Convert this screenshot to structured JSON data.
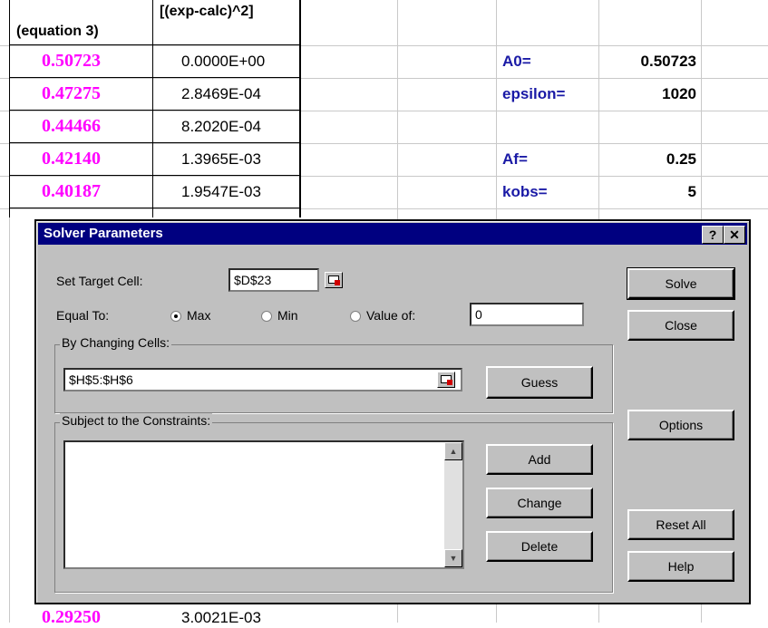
{
  "sheet": {
    "col_headers": [
      "(equation 3)",
      "[(exp-calc)^2]"
    ],
    "rows": [
      {
        "calc": "0.50723",
        "sq": "0.0000E+00"
      },
      {
        "calc": "0.47275",
        "sq": "2.8469E-04"
      },
      {
        "calc": "0.44466",
        "sq": "8.2020E-04"
      },
      {
        "calc": "0.42140",
        "sq": "1.3965E-03"
      },
      {
        "calc": "0.40187",
        "sq": "1.9547E-03"
      }
    ],
    "bottom_row": {
      "calc": "0.29250",
      "sq": "3.0021E-03"
    },
    "params": [
      {
        "label": "A0=",
        "value": "0.50723"
      },
      {
        "label": "epsilon=",
        "value": "1020"
      },
      {
        "label": "Af=",
        "value": "0.25"
      },
      {
        "label": "kobs=",
        "value": "5"
      }
    ]
  },
  "dialog": {
    "title": "Solver Parameters",
    "help_glyph": "?",
    "close_glyph": "✕",
    "target_label": "Set Target Cell:",
    "target_value": "$D$23",
    "equal_to_label": "Equal To:",
    "radio_max": "Max",
    "radio_min": "Min",
    "radio_value_of": "Value of:",
    "value_of_value": "0",
    "changing_label": "By Changing Cells:",
    "changing_value": "$H$5:$H$6",
    "constraints_label": "Subject to the Constraints:",
    "buttons": {
      "solve": "Solve",
      "close": "Close",
      "guess": "Guess",
      "options": "Options",
      "add": "Add",
      "change": "Change",
      "delete": "Delete",
      "reset_all": "Reset All",
      "help": "Help"
    }
  }
}
